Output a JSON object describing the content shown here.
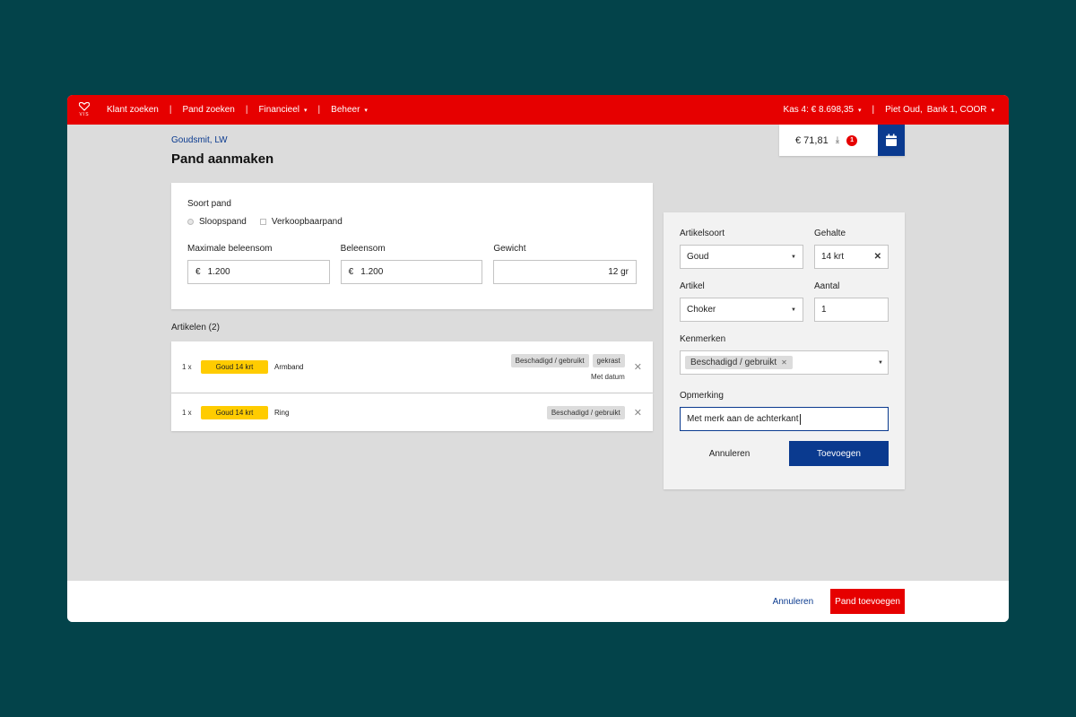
{
  "nav": {
    "logo_text": "VIS",
    "items": [
      {
        "label": "Klant zoeken"
      },
      {
        "label": "Pand zoeken"
      },
      {
        "label": "Financieel"
      },
      {
        "label": "Beheer"
      }
    ],
    "cash_register": "Kas 4: € 8.698,35",
    "user_name": "Piet Oud,",
    "user_location": "Bank 1, COOR"
  },
  "page": {
    "breadcrumb": "Goudsmit, LW",
    "title": "Pand aanmaken"
  },
  "cashbox": {
    "amount": "€ 71,81",
    "badge_count": "1"
  },
  "pawn_form": {
    "type_label": "Soort pand",
    "option_scrap": "Sloopspand",
    "option_sale": "Verkoopbaarpand",
    "max_loan_label": "Maximale beleensom",
    "max_loan_currency": "€",
    "max_loan_value": "1.200",
    "loan_label": "Beleensom",
    "loan_currency": "€",
    "loan_value": "1.200",
    "weight_label": "Gewicht",
    "weight_value": "12 gr"
  },
  "articles": {
    "heading": "Artikelen (2)",
    "rows": [
      {
        "qty": "1 x",
        "metal": "Goud 14 krt",
        "name": "Armband",
        "tags": [
          "Beschadigd / gebruikt",
          "gekrast"
        ],
        "note": "Met datum"
      },
      {
        "qty": "1 x",
        "metal": "Goud 14 krt",
        "name": "Ring",
        "tags": [
          "Beschadigd / gebruikt"
        ],
        "note": ""
      }
    ]
  },
  "article_form": {
    "type_label": "Artikelsoort",
    "type_value": "Goud",
    "purity_label": "Gehalte",
    "purity_value": "14 krt",
    "article_label": "Artikel",
    "article_value": "Choker",
    "amount_label": "Aantal",
    "amount_value": "1",
    "features_label": "Kenmerken",
    "feature_pill": "Beschadigd / gebruikt",
    "remark_label": "Opmerking",
    "remark_value": "Met merk aan de achterkant",
    "cancel_label": "Annuleren",
    "submit_label": "Toevoegen"
  },
  "footer": {
    "cancel_label": "Annuleren",
    "submit_label": "Pand toevoegen"
  },
  "colors": {
    "brand_red": "#e60000",
    "primary_blue": "#0a3a8f",
    "gold_tag": "#ffcc00",
    "backdrop": "#03434a"
  }
}
